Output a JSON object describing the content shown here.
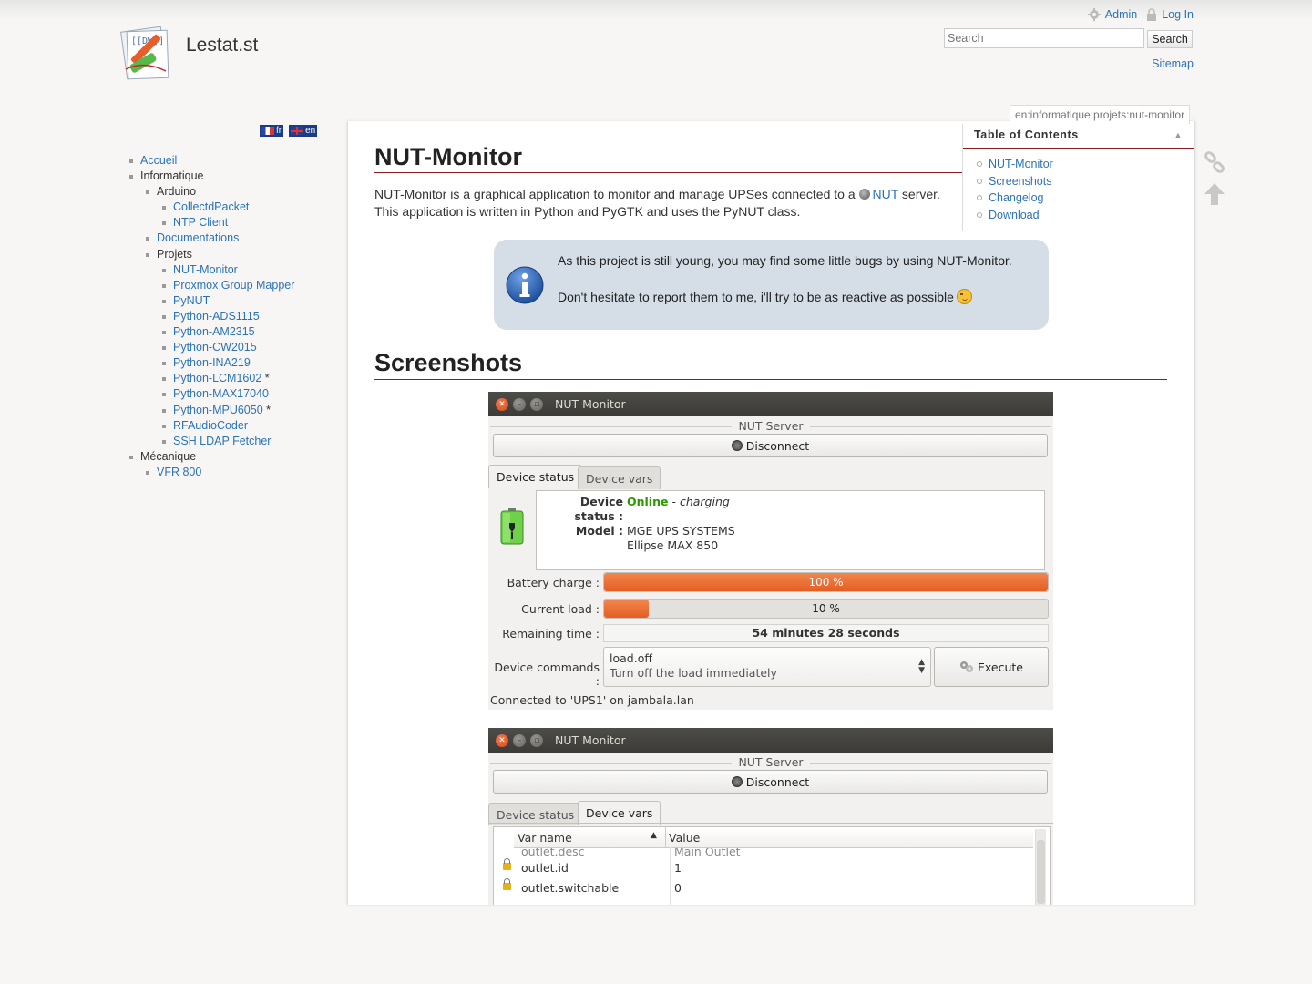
{
  "header": {
    "site_title": "Lestat.st",
    "admin_label": "Admin",
    "login_label": "Log In",
    "search_placeholder": "Search",
    "search_button": "Search",
    "sitemap_label": "Sitemap",
    "page_id": "en:informatique:projets:nut-monitor"
  },
  "languages": [
    {
      "code": "fr"
    },
    {
      "code": "en"
    }
  ],
  "sidebar": {
    "accueil": "Accueil",
    "informatique": "Informatique",
    "arduino": "Arduino",
    "arduino_items": [
      "CollectdPacket",
      "NTP Client"
    ],
    "documentations": "Documentations",
    "projets": "Projets",
    "projets_items": [
      "NUT-Monitor",
      "Proxmox Group Mapper",
      "PyNUT",
      "Python-ADS1115",
      "Python-AM2315",
      "Python-CW2015",
      "Python-INA219",
      "Python-LCM1602",
      "Python-MAX17040",
      "Python-MPU6050",
      "RFAudioCoder",
      "SSH LDAP Fetcher"
    ],
    "star": "*",
    "mecanique": "Mécanique",
    "mecanique_items": [
      "VFR 800"
    ]
  },
  "toc": {
    "title": "Table of Contents",
    "items": [
      "NUT-Monitor",
      "Screenshots",
      "Changelog",
      "Download"
    ]
  },
  "content": {
    "h1": "NUT-Monitor",
    "intro_before": "NUT-Monitor is a graphical application to monitor and manage UPSes connected to a ",
    "intro_link": "NUT",
    "intro_after": " server.",
    "intro_line2": "This application is written in Python and PyGTK and uses the PyNUT class.",
    "note_line1": "As this project is still young, you may find some little bugs by using NUT-Monitor.",
    "note_line2": "Don't hesitate to report them to me, i'll try to be as reactive as possible",
    "h2": "Screenshots"
  },
  "window1": {
    "title": "NUT Monitor",
    "frame_label": "NUT Server",
    "disconnect": "Disconnect",
    "tab_status": "Device status",
    "tab_vars": "Device vars",
    "status_key": "Device status :",
    "status_online": "Online",
    "status_sep": " - ",
    "status_charging": "charging",
    "model_key": "Model :",
    "model_line1": "MGE UPS SYSTEMS",
    "model_line2": "Ellipse MAX 850",
    "battery_label": "Battery charge :",
    "battery_value": 100,
    "battery_text": "100 %",
    "load_label": "Current load :",
    "load_value": 10,
    "load_text": "10 %",
    "remaining_label": "Remaining time :",
    "remaining_value": "54 minutes 28 seconds",
    "commands_label": "Device commands :",
    "command_name": "load.off",
    "command_desc": "Turn off the load immediately",
    "execute": "Execute",
    "statusbar": "Connected to 'UPS1' on jambala.lan"
  },
  "window2": {
    "title": "NUT Monitor",
    "frame_label": "NUT Server",
    "disconnect": "Disconnect",
    "tab_status": "Device status",
    "tab_vars": "Device vars",
    "col_name": "Var name",
    "col_value": "Value",
    "rows": [
      {
        "name": "outlet.desc",
        "value": "Main Outlet"
      },
      {
        "name": "outlet.id",
        "value": "1"
      },
      {
        "name": "outlet.switchable",
        "value": "0"
      }
    ]
  }
}
